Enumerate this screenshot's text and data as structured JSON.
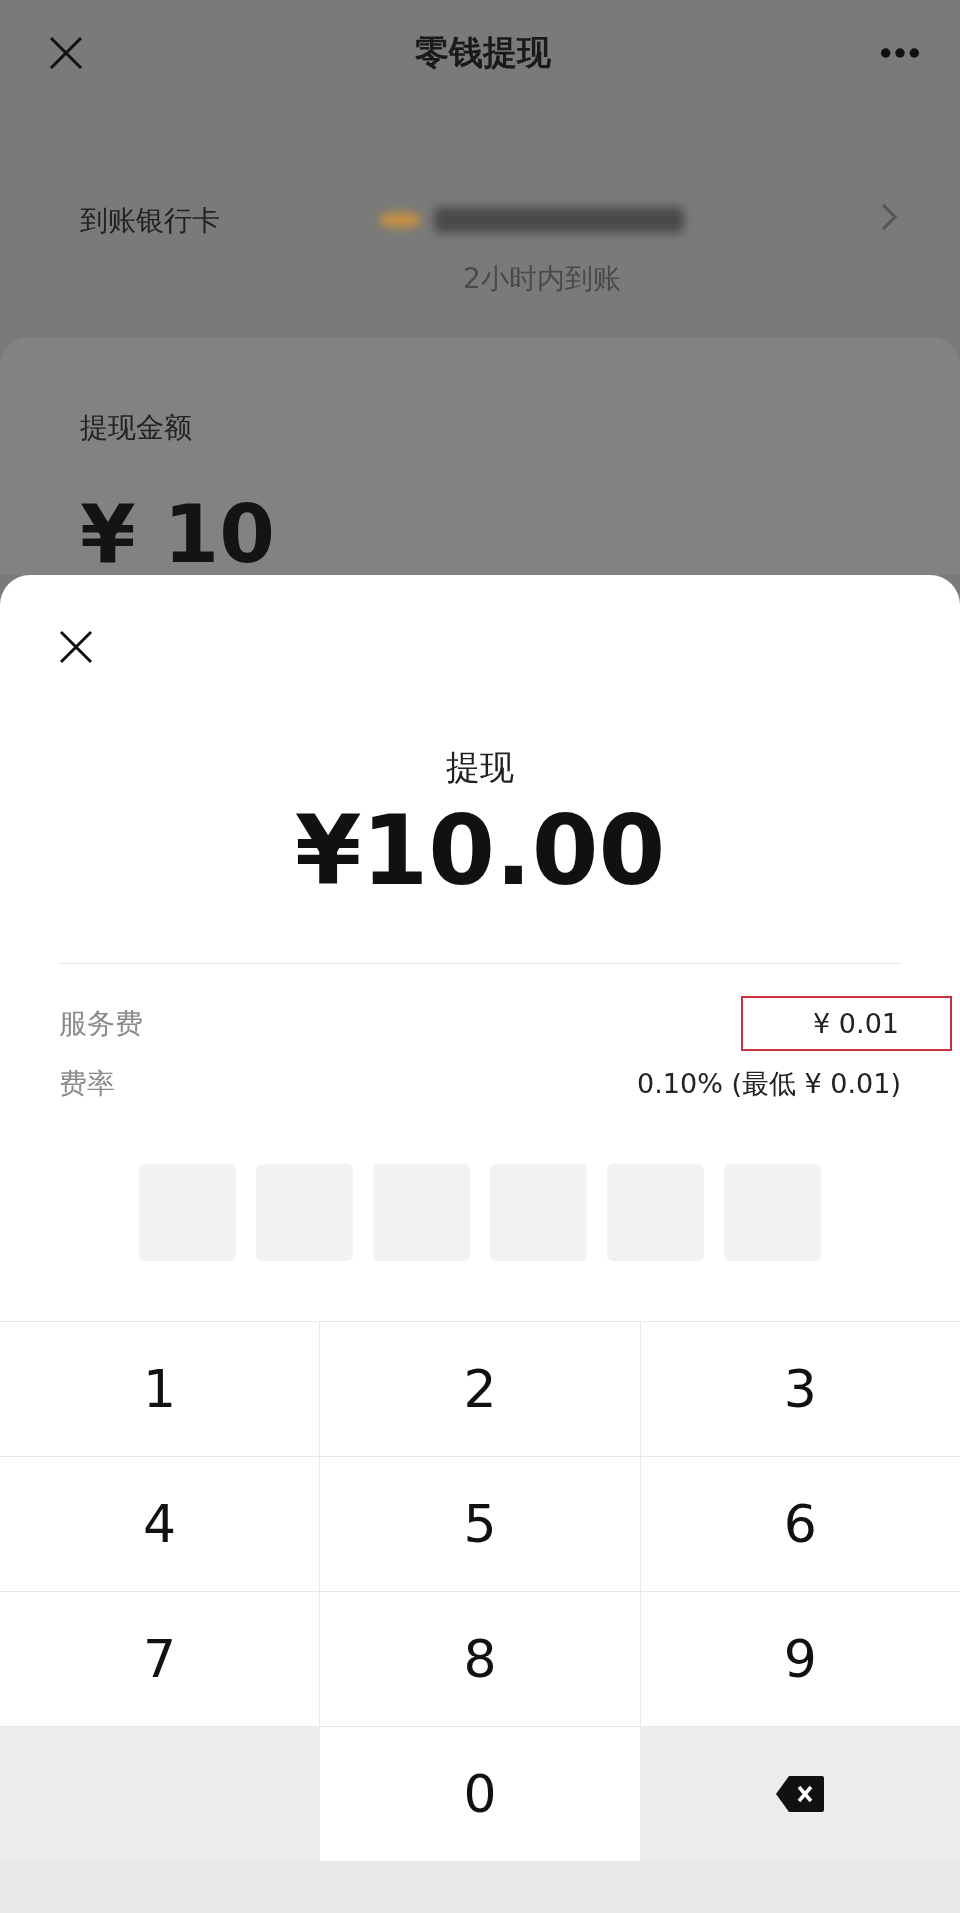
{
  "navbar": {
    "title": "零钱提现"
  },
  "bank_row": {
    "label": "到账银行卡",
    "arrival_note": "2小时内到账"
  },
  "amount_card": {
    "label": "提现金额",
    "amount": "¥ 10"
  },
  "sheet": {
    "title": "提现",
    "amount": "¥10.00",
    "fees": [
      {
        "label": "服务费",
        "value": "¥ 0.01",
        "highlighted": true
      },
      {
        "label": "费率",
        "value": "0.10% (最低 ¥ 0.01)",
        "highlighted": false
      }
    ],
    "pin_boxes": [
      {
        "filled": false
      },
      {
        "filled": false
      },
      {
        "filled": false
      },
      {
        "filled": false
      },
      {
        "filled": false
      },
      {
        "filled": false
      }
    ],
    "keypad": [
      {
        "kind": "digit",
        "label": "1"
      },
      {
        "kind": "digit",
        "label": "2"
      },
      {
        "kind": "digit",
        "label": "3"
      },
      {
        "kind": "digit",
        "label": "4"
      },
      {
        "kind": "digit",
        "label": "5"
      },
      {
        "kind": "digit",
        "label": "6"
      },
      {
        "kind": "digit",
        "label": "7"
      },
      {
        "kind": "digit",
        "label": "8"
      },
      {
        "kind": "digit",
        "label": "9"
      },
      {
        "kind": "blank"
      },
      {
        "kind": "digit",
        "label": "0"
      },
      {
        "kind": "backspace"
      }
    ]
  }
}
